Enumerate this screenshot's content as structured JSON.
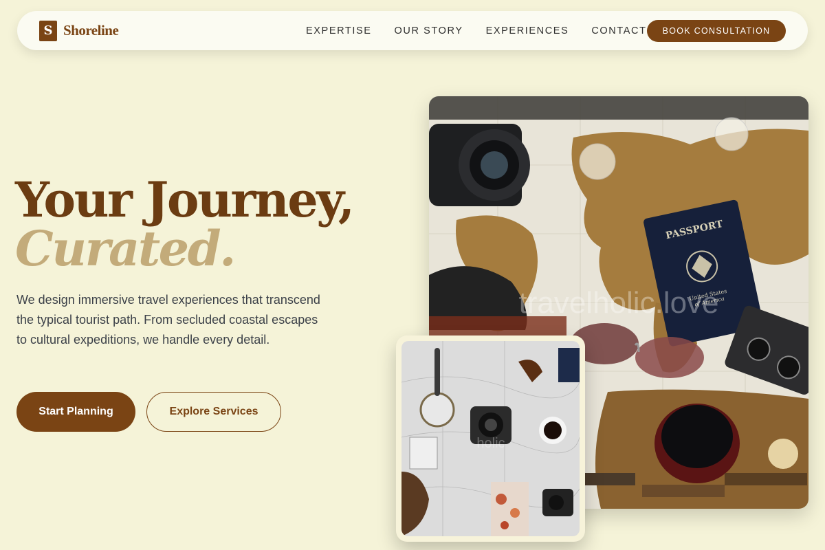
{
  "brand": {
    "mark": "S",
    "name": "Shoreline"
  },
  "nav": {
    "links": [
      "EXPERTISE",
      "OUR STORY",
      "EXPERIENCES",
      "CONTACT"
    ],
    "cta": "BOOK CONSULTATION"
  },
  "hero": {
    "title": "Your Journey,",
    "subtitle": "Curated.",
    "description": "We design immersive travel experiences that transcend the typical tourist path. From secluded coastal escapes to cultural expeditions, we handle every detail.",
    "primary_button": "Start Planning",
    "secondary_button": "Explore Services"
  },
  "images": {
    "main": {
      "passport_label": "PASSPORT",
      "passport_sub1": "United States",
      "passport_sub2": "of America",
      "watermark": "travelholic.love"
    },
    "small": {
      "watermark": "holic"
    }
  },
  "colors": {
    "brand": "#7a4414",
    "accent": "#c3ab7a",
    "background": "#f5f3d8"
  }
}
